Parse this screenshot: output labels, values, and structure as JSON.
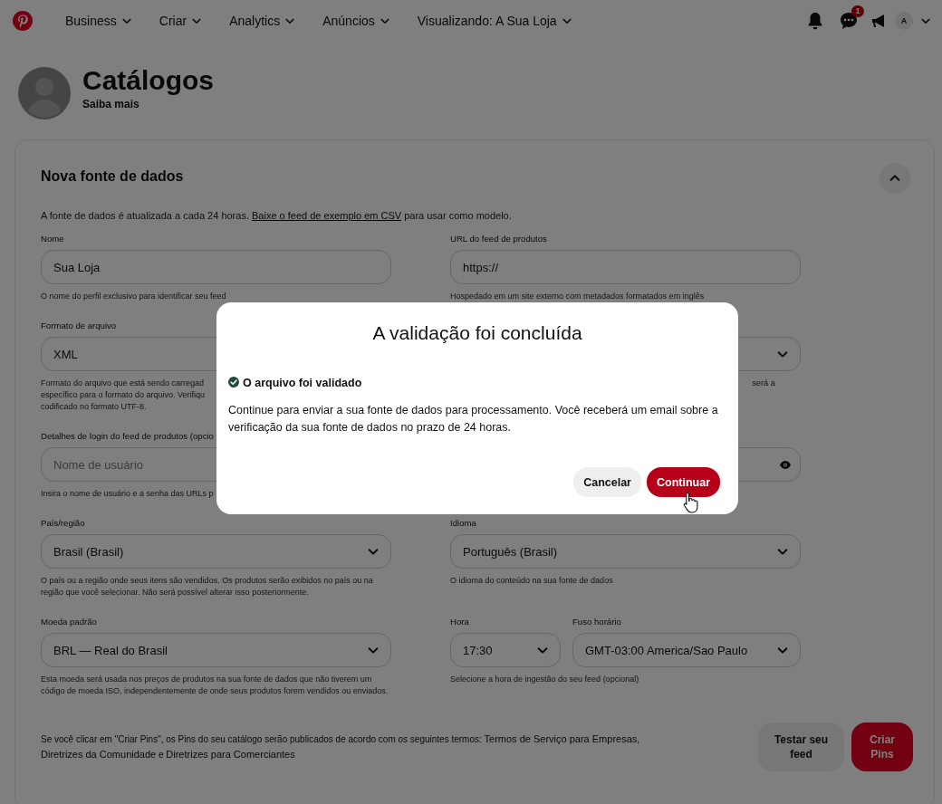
{
  "nav": {
    "items": [
      {
        "label": "Business"
      },
      {
        "label": "Criar"
      },
      {
        "label": "Analytics"
      },
      {
        "label": "Anúncios"
      },
      {
        "label": "Visualizando: A Sua Loja"
      }
    ],
    "messages_badge": "1",
    "avatar_letter": "A"
  },
  "header": {
    "title": "Catálogos",
    "link": "Saiba mais"
  },
  "form": {
    "title": "Nova fonte de dados",
    "expanded": true,
    "intro": [
      {
        "kind": "text",
        "text": "A fonte de dados é atualizada a cada 24 horas. "
      },
      {
        "kind": "link",
        "text": "Baixe o feed de exemplo em CSV"
      },
      {
        "kind": "text",
        "text": " para usar como modelo."
      }
    ],
    "rows": [
      {
        "left": [
          {
            "kind": "text",
            "label": "Nome",
            "value": "Sua Loja",
            "helper": [
              "O nome do perfil exclusivo para identificar seu feed"
            ]
          }
        ],
        "right": [
          {
            "kind": "text",
            "label": "URL do feed de produtos",
            "value": "https://",
            "helper": [
              "Hospedado em um site externo com metadados formatados em inglês"
            ]
          }
        ]
      },
      {
        "left": [
          {
            "kind": "select",
            "label": "Formato de arquivo",
            "value": "XML",
            "helper": [
              "Formato do arquivo que está sendo carregad",
              "específico para o formato do arquivo. Verifiqu",
              "codificado no formato UTF-8."
            ]
          }
        ],
        "right": [
          {
            "kind": "select",
            "helper_right": [
              "será a"
            ]
          }
        ]
      },
      {
        "left": [
          {
            "kind": "text",
            "label": "Detalhes de login do feed de produtos (opcio",
            "placeholder": "Nome de usuário",
            "helper": [
              "Insira o nome de usuário e a senha das URLs p"
            ]
          }
        ],
        "right": [
          {
            "kind": "password"
          }
        ]
      },
      {
        "left": [
          {
            "kind": "select",
            "label": "País/região",
            "value": "Brasil (Brasil)",
            "helper": [
              "O país ou a região onde seus itens são vendidos. Os produtos serão exibidos no país ou na região que você selecionar. Não será possível alterar isso posteriormente."
            ]
          }
        ],
        "right": [
          {
            "kind": "select",
            "label": "Idioma",
            "value": "Português (Brasil)",
            "helper": [
              "O idioma do conteúdo na sua fonte de dados"
            ]
          }
        ]
      },
      {
        "left": [
          {
            "kind": "select",
            "label": "Moeda padrão",
            "value": "BRL — Real do Brasil",
            "helper": [
              "Esta moeda será usada nos preços de produtos na sua fonte de dados que não tiverem um código de moeda ISO, independentemente de onde seus produtos forem vendidos ou enviados."
            ]
          }
        ],
        "right": [
          {
            "kind": "select",
            "label": "Hora",
            "value": "17:30"
          },
          {
            "kind": "select",
            "label": "Fuso horário",
            "value": "GMT-03:00 America/Sao Paulo"
          }
        ],
        "right_helper": "Selecione a hora de ingestão do seu feed (opcional)"
      }
    ],
    "terms": [
      {
        "kind": "text",
        "text": "Se você clicar em \"Criar Pins\", os Pins do seu catálogo serão publicados de acordo com os seguintes termos: "
      },
      {
        "kind": "link",
        "text": "Termos de Serviço para Empresas"
      },
      {
        "kind": "text",
        "text": ", "
      },
      {
        "kind": "link",
        "text": "Diretrizes da Comunidade"
      },
      {
        "kind": "text",
        "text": " e "
      },
      {
        "kind": "link",
        "text": "Diretrizes para Comerciantes"
      }
    ],
    "buttons": [
      {
        "label": "Testar seu feed",
        "kind": "secondary"
      },
      {
        "label": "Criar Pins",
        "kind": "primary"
      }
    ]
  },
  "modal": {
    "title": "A validação foi concluída",
    "status": "O arquivo foi validado",
    "body": "Continue para enviar a sua fonte de dados para processamento. Você receberá um email sobre a verificação da sua fonte de dados no prazo de 24 horas.",
    "buttons": [
      {
        "label": "Cancelar",
        "kind": "secondary"
      },
      {
        "label": "Continuar",
        "kind": "primary"
      }
    ]
  }
}
